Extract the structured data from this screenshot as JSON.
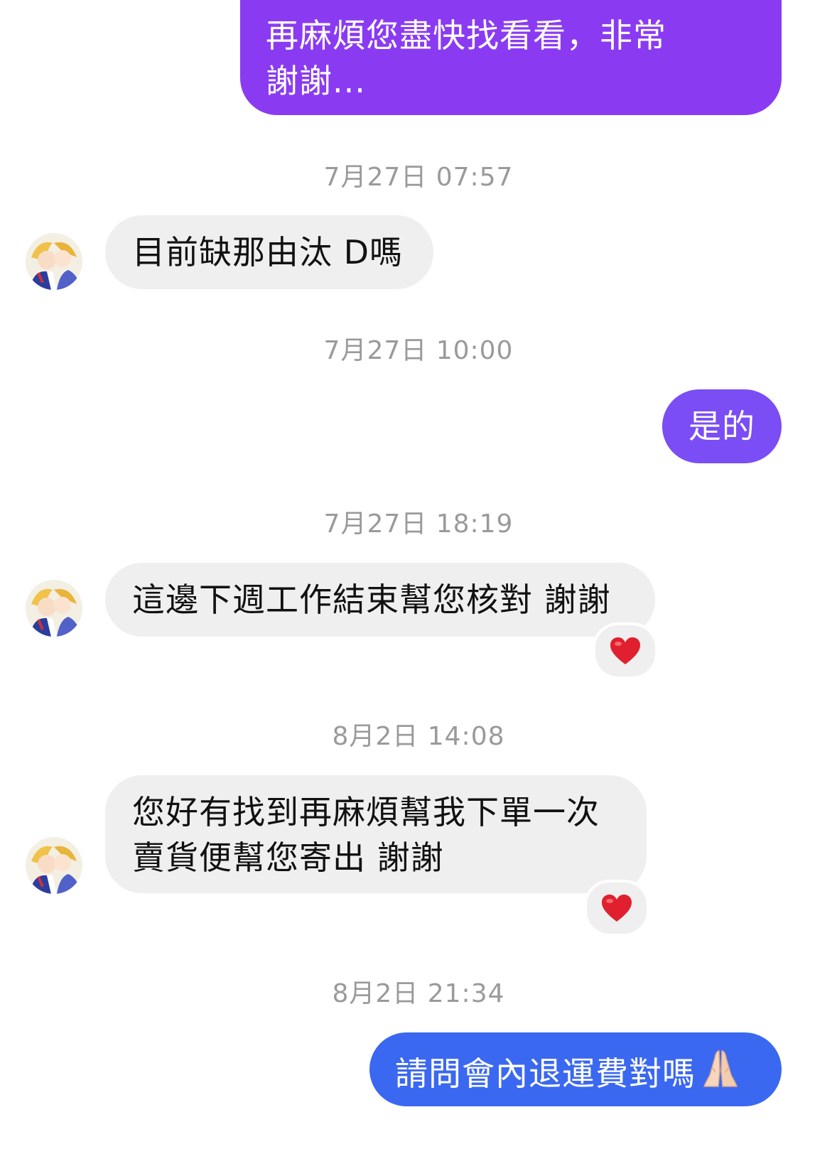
{
  "theme": {
    "outgoing_top_color": "#8a3bf2",
    "outgoing_mid_color": "#7a4df5",
    "outgoing_bottom_color": "#3b68f0",
    "incoming_color": "#efefef",
    "timestamp_color": "#9a9a9a"
  },
  "messages": [
    {
      "id": "m1",
      "direction": "outgoing",
      "lines": [
        "再麻煩您盡快找看看，非常",
        "謝謝..."
      ]
    },
    {
      "id": "ts1",
      "type": "timestamp",
      "text": "7月27日 07:57"
    },
    {
      "id": "m2",
      "direction": "incoming",
      "lines": [
        "目前缺那由汰 D嗎"
      ]
    },
    {
      "id": "ts2",
      "type": "timestamp",
      "text": "7月27日 10:00"
    },
    {
      "id": "m3",
      "direction": "outgoing",
      "lines": [
        "是的"
      ]
    },
    {
      "id": "ts3",
      "type": "timestamp",
      "text": "7月27日 18:19"
    },
    {
      "id": "m4",
      "direction": "incoming",
      "lines": [
        "這邊下週工作結束幫您核對 謝謝"
      ],
      "reaction": "heart-emoji"
    },
    {
      "id": "ts4",
      "type": "timestamp",
      "text": "8月2日 14:08"
    },
    {
      "id": "m5",
      "direction": "incoming",
      "lines": [
        "您好有找到再麻煩幫我下單一次",
        "賣貨便幫您寄出 謝謝"
      ],
      "reaction": "heart-emoji"
    },
    {
      "id": "ts5",
      "type": "timestamp",
      "text": "8月2日 21:34"
    },
    {
      "id": "m6",
      "direction": "outgoing",
      "lines": [
        "請問會內退運費對嗎"
      ],
      "trailing_emoji": "folded-hands-emoji"
    }
  ]
}
